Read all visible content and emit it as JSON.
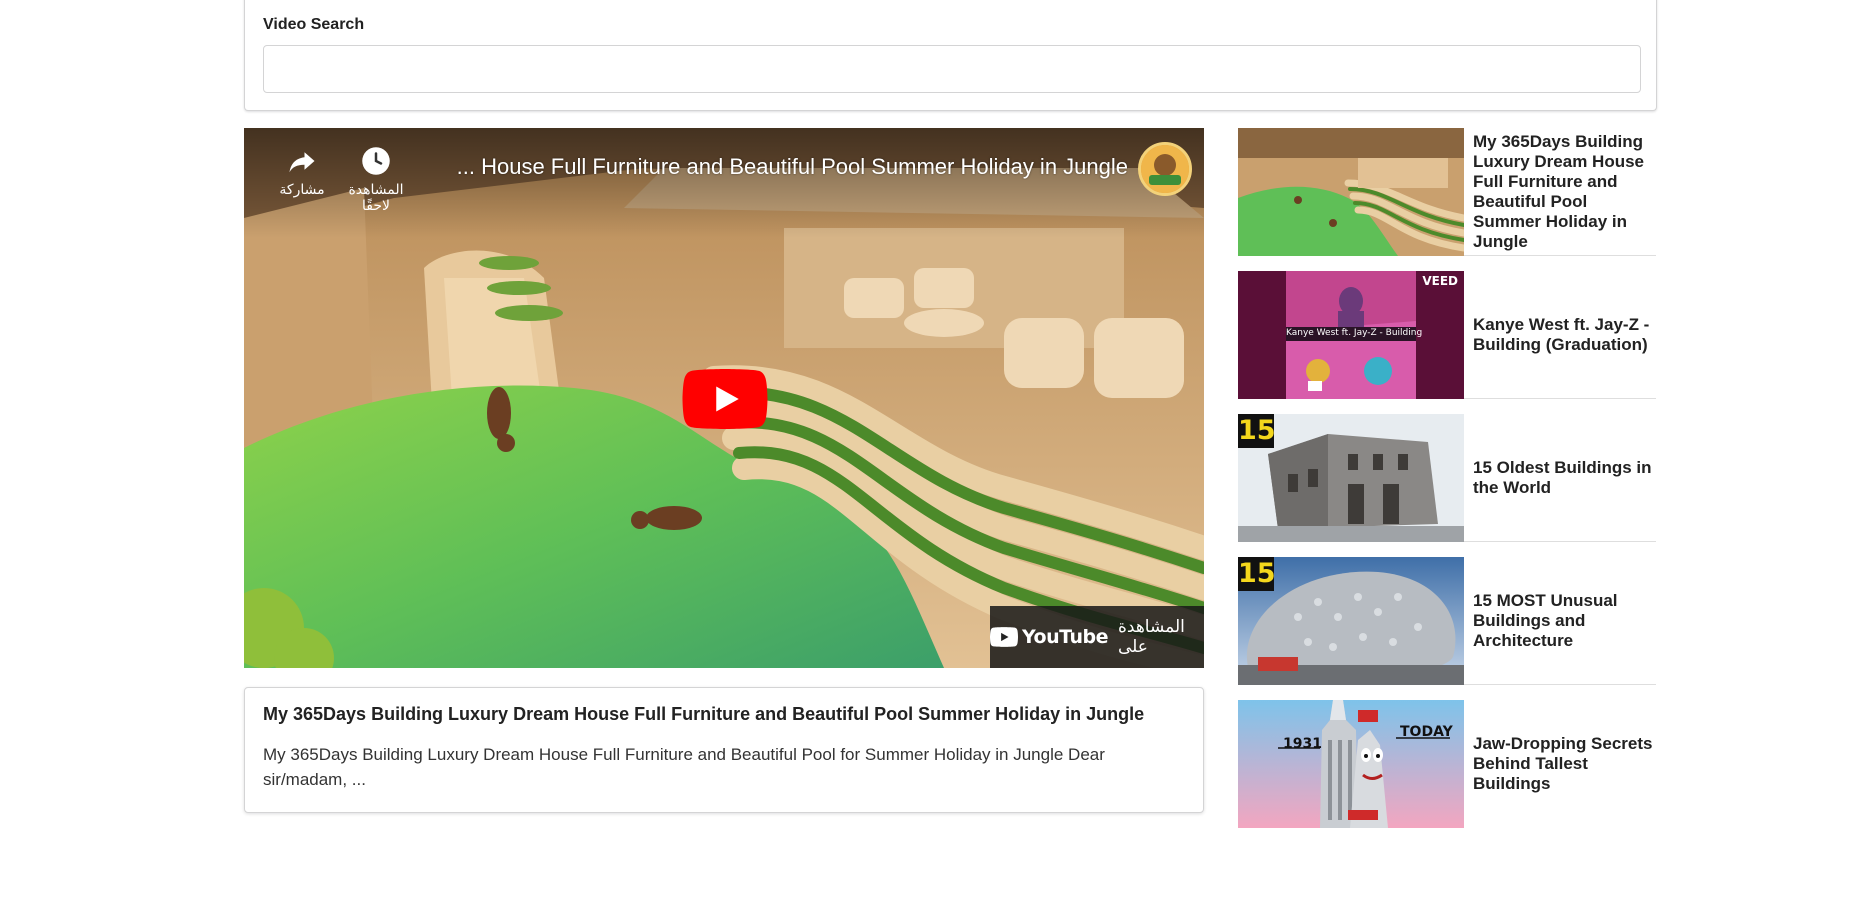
{
  "search": {
    "label": "Video Search",
    "value": "",
    "placeholder": ""
  },
  "player": {
    "title": "... House Full Furniture and Beautiful Pool Summer Holiday in Jungle",
    "share_label": "مشاركة",
    "watch_later_label": "المشاهدة لاحقًا",
    "watch_on_label": "المشاهدة على",
    "youtube_brand": "YouTube",
    "play_icon": "play-icon"
  },
  "selected_video": {
    "title": "My 365Days Building Luxury Dream House Full Furniture and Beautiful Pool Summer Holiday in Jungle",
    "description": "My 365Days Building Luxury Dream House Full Furniture and Beautiful Pool for Summer Holiday in Jungle Dear sir/madam, ..."
  },
  "video_list": [
    {
      "title": "My 365Days Building Luxury Dream House Full Furniture and Beautiful Pool Summer Holiday in Jungle"
    },
    {
      "title": "Kanye West ft. Jay-Z - Building (Graduation)",
      "thumb_caption": "Kanye West ft. Jay-Z - Building",
      "thumb_tag": "VEED"
    },
    {
      "title": "15 Oldest Buildings in the World",
      "thumb_badge": "15"
    },
    {
      "title": "15 MOST Unusual Buildings and Architecture",
      "thumb_badge": "15"
    },
    {
      "title": "Jaw-Dropping Secrets Behind Tallest Buildings",
      "thumb_year": "1931",
      "thumb_today": "TODAY"
    }
  ],
  "colors": {
    "youtube_red": "#ff0000",
    "border": "#d4d4d5",
    "text": "#222222"
  }
}
